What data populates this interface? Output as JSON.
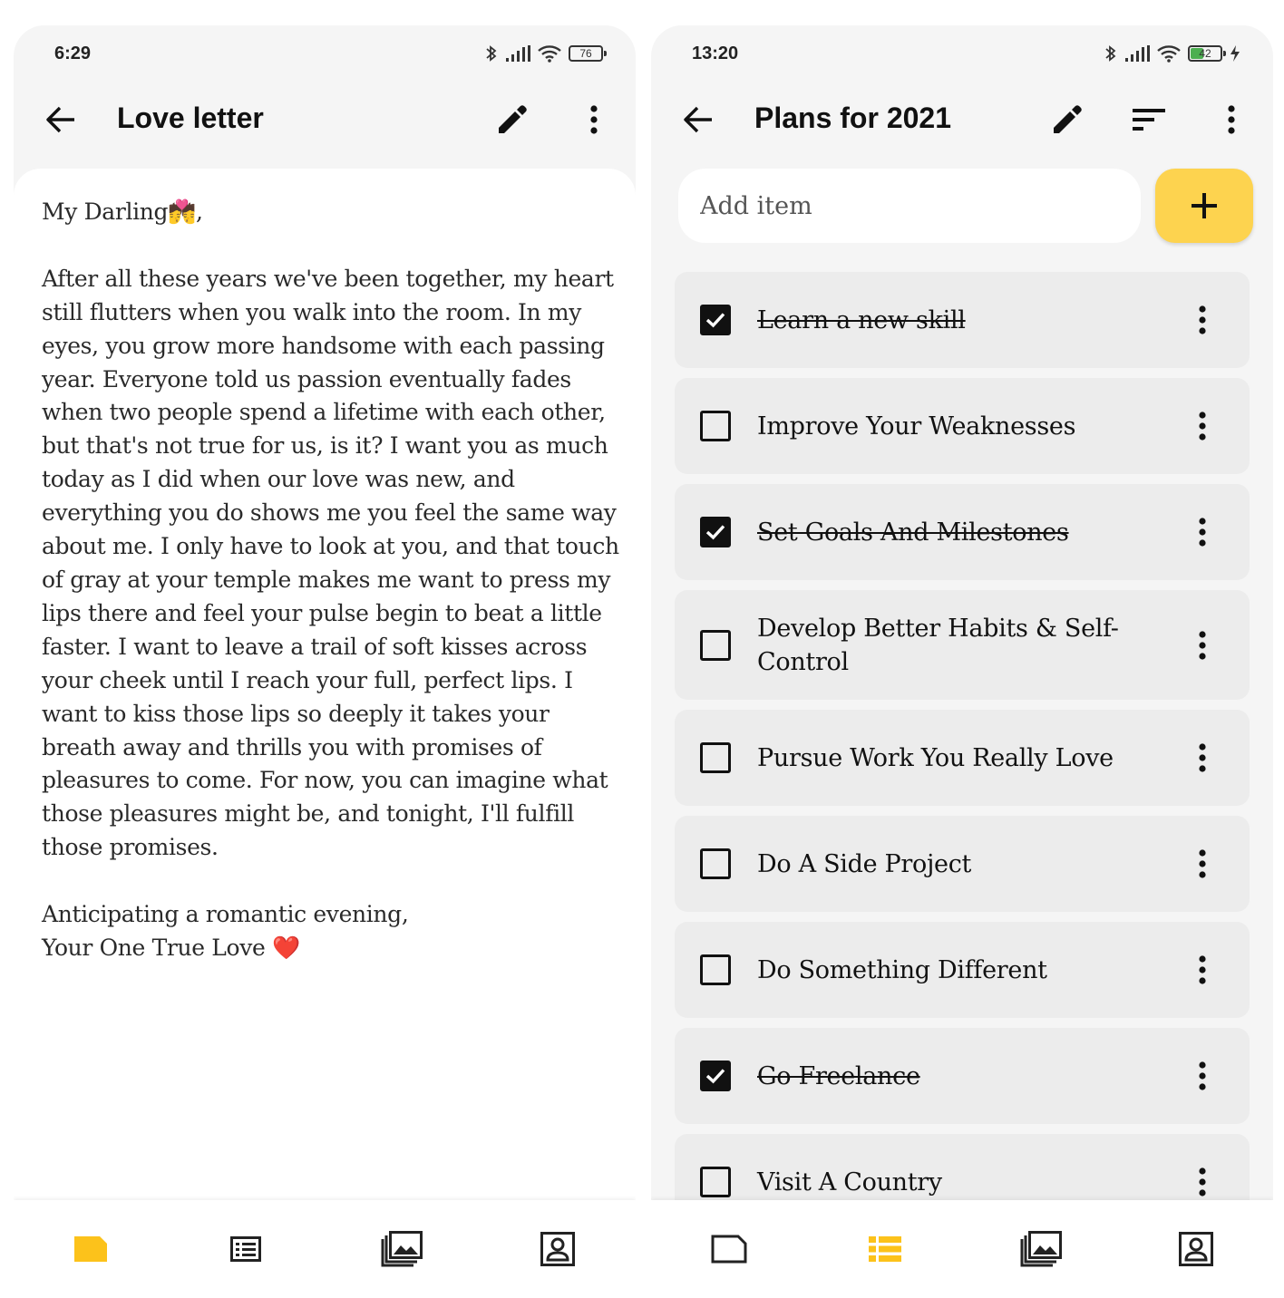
{
  "left_screen": {
    "status": {
      "time": "6:29",
      "battery": "76"
    },
    "app_bar": {
      "title": "Love letter"
    },
    "note": {
      "greeting": "My Darling💏,",
      "body": "After all these years we've been together, my heart still flutters when you walk into the room. In my eyes, you grow more handsome with each passing year. Everyone told us passion eventually fades when two people spend a lifetime with each other, but that's not true for us, is it? I want you as much today as I did when our love was new, and everything you do shows me you feel the same way about me. I only have to look at you, and that touch of gray at your temple makes me want to press my lips there and feel your pulse begin to beat a little faster. I want to leave a trail of soft kisses across your cheek until I reach your full, perfect lips. I want to kiss those lips so deeply it takes your breath away and thrills you with promises of pleasures to come. For now, you can imagine what those pleasures might be, and tonight, I'll fulfill those promises.",
      "closing": "Anticipating a romantic evening,",
      "signature": "Your One True Love ❤️"
    },
    "active_tab": "notes"
  },
  "right_screen": {
    "status": {
      "time": "13:20",
      "battery": "42"
    },
    "app_bar": {
      "title": "Plans for 2021"
    },
    "add_item": {
      "placeholder": "Add item",
      "button_icon": "plus-icon"
    },
    "items": [
      {
        "label": "Learn a new skill",
        "checked": true
      },
      {
        "label": "Improve Your Weaknesses",
        "checked": false
      },
      {
        "label": "Set Goals And Milestones",
        "checked": true
      },
      {
        "label": "Develop Better Habits & Self-Control",
        "checked": false
      },
      {
        "label": "Pursue Work You Really Love",
        "checked": false
      },
      {
        "label": "Do A Side Project",
        "checked": false
      },
      {
        "label": "Do Something Different",
        "checked": false
      },
      {
        "label": "Go Freelance",
        "checked": true
      },
      {
        "label": "Visit A Country",
        "checked": false
      }
    ],
    "active_tab": "lists"
  },
  "nav": {
    "tabs": [
      {
        "id": "notes",
        "icon": "note-icon"
      },
      {
        "id": "lists",
        "icon": "list-icon"
      },
      {
        "id": "gallery",
        "icon": "gallery-icon"
      },
      {
        "id": "contacts",
        "icon": "contact-icon"
      }
    ]
  },
  "colors": {
    "accent": "#fdd34f",
    "nav_active": "#fcc21b",
    "item_bg": "#ececec",
    "bar_bg": "#f5f5f5"
  }
}
